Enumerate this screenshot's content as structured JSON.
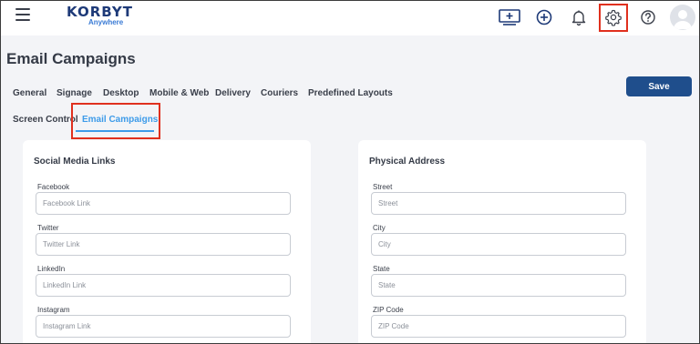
{
  "app": {
    "logo_text": "KORBYT",
    "logo_subtext": "Anywhere"
  },
  "topbar": {
    "icons": [
      "hamburger-menu-icon",
      "screen-add-icon",
      "plus-circle-icon",
      "bell-icon",
      "gear-icon",
      "help-icon",
      "avatar-icon"
    ]
  },
  "page": {
    "title": "Email Campaigns"
  },
  "tabs": {
    "row1": [
      "General",
      "Signage",
      "Desktop",
      "Mobile & Web",
      "Delivery",
      "Couriers",
      "Predefined Layouts"
    ],
    "row2": [
      "Screen Control",
      "Email Campaigns"
    ],
    "active": "Email Campaigns"
  },
  "toolbar": {
    "save_label": "Save"
  },
  "social_media": {
    "title": "Social Media Links",
    "fields": [
      {
        "label": "Facebook",
        "placeholder": "Facebook Link",
        "value": ""
      },
      {
        "label": "Twitter",
        "placeholder": "Twitter Link",
        "value": ""
      },
      {
        "label": "LinkedIn",
        "placeholder": "LinkedIn Link",
        "value": ""
      },
      {
        "label": "Instagram",
        "placeholder": "Instagram Link",
        "value": ""
      }
    ]
  },
  "physical_address": {
    "title": "Physical Address",
    "fields": [
      {
        "label": "Street",
        "placeholder": "Street",
        "value": ""
      },
      {
        "label": "City",
        "placeholder": "City",
        "value": ""
      },
      {
        "label": "State",
        "placeholder": "State",
        "value": ""
      },
      {
        "label": "ZIP Code",
        "placeholder": "ZIP Code",
        "value": ""
      }
    ]
  },
  "colors": {
    "accent": "#3d9be9",
    "primary_button": "#1f4e8c",
    "highlight": "#e0301e",
    "background": "#f3f4f7"
  }
}
